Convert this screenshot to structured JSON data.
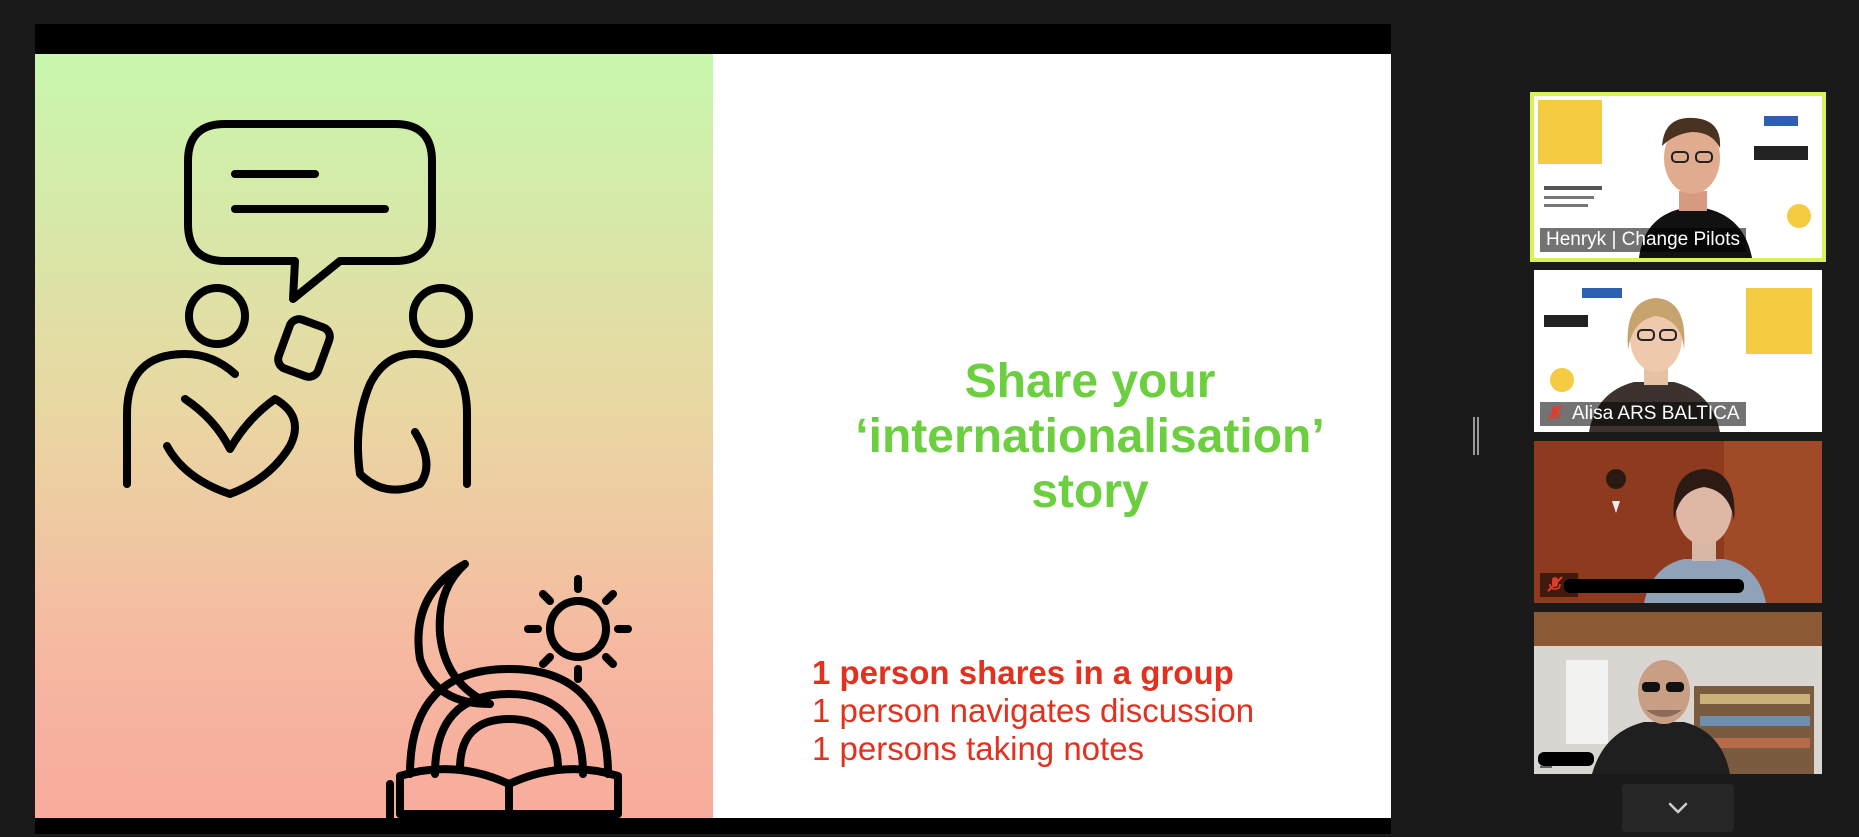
{
  "slide": {
    "title_lines": [
      "Share your",
      "‘internationalisation’",
      "story"
    ],
    "steps": [
      "1 person shares in a group",
      "1 person navigates discussion",
      "1 persons taking notes"
    ]
  },
  "participants": [
    {
      "name": "Henryk | Change Pilots",
      "muted": false,
      "active": true
    },
    {
      "name": "Alisa ARS BALTICA",
      "muted": true,
      "active": false
    },
    {
      "name": "",
      "muted": true,
      "active": false
    },
    {
      "name": "",
      "muted": false,
      "active": false
    }
  ],
  "colors": {
    "title_green": "#6ccf3f",
    "steps_red": "#e2311e",
    "active_speaker_border": "#d8f25a"
  },
  "icons": [
    "chat-bubble-icon",
    "people-talking-icon",
    "moon-icon",
    "sun-icon",
    "rainbow-book-icon",
    "chevron-down-icon",
    "mic-muted-icon"
  ]
}
